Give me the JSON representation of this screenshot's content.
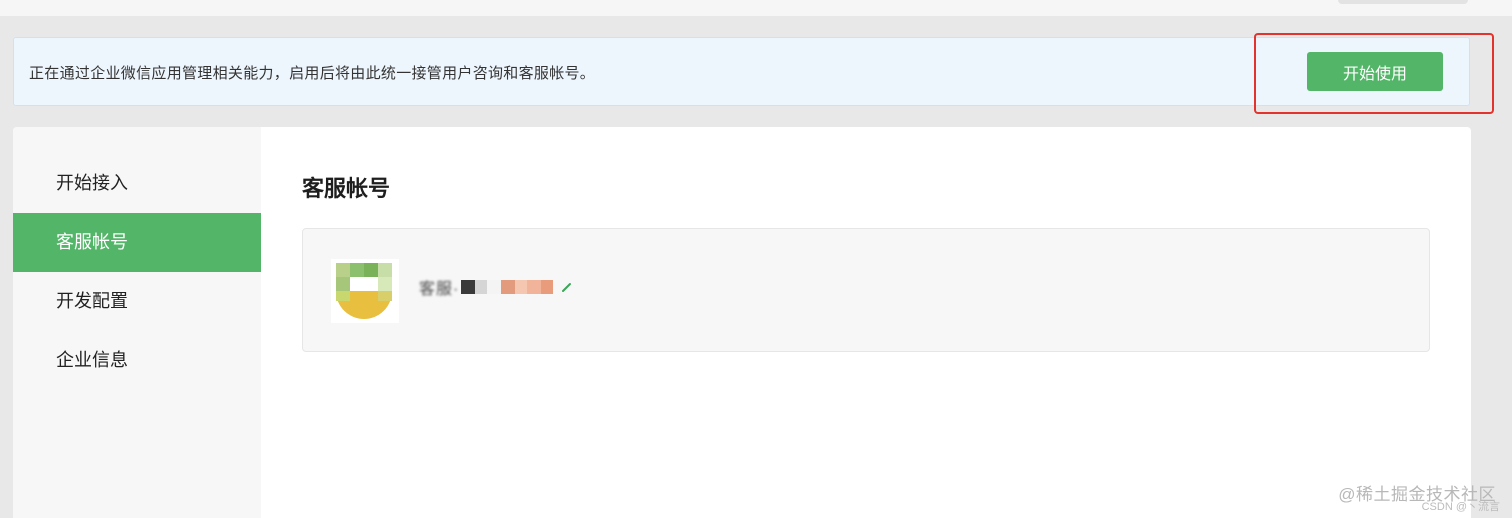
{
  "notice": {
    "text": "正在通过企业微信应用管理相关能力，启用后将由此统一接管用户咨询和客服帐号。",
    "start_button": "开始使用"
  },
  "sidebar": {
    "items": [
      {
        "label": "开始接入",
        "active": false
      },
      {
        "label": "客服帐号",
        "active": true
      },
      {
        "label": "开发配置",
        "active": false
      },
      {
        "label": "企业信息",
        "active": false
      }
    ]
  },
  "content": {
    "title": "客服帐号",
    "account": {
      "name": "客服·"
    }
  },
  "watermark": {
    "main": "@稀土掘金技术社区",
    "sub": "CSDN @丶流言"
  },
  "colors": {
    "accent": "#52b567",
    "highlight": "#e2332d",
    "notice_bg": "#eef6fd"
  }
}
